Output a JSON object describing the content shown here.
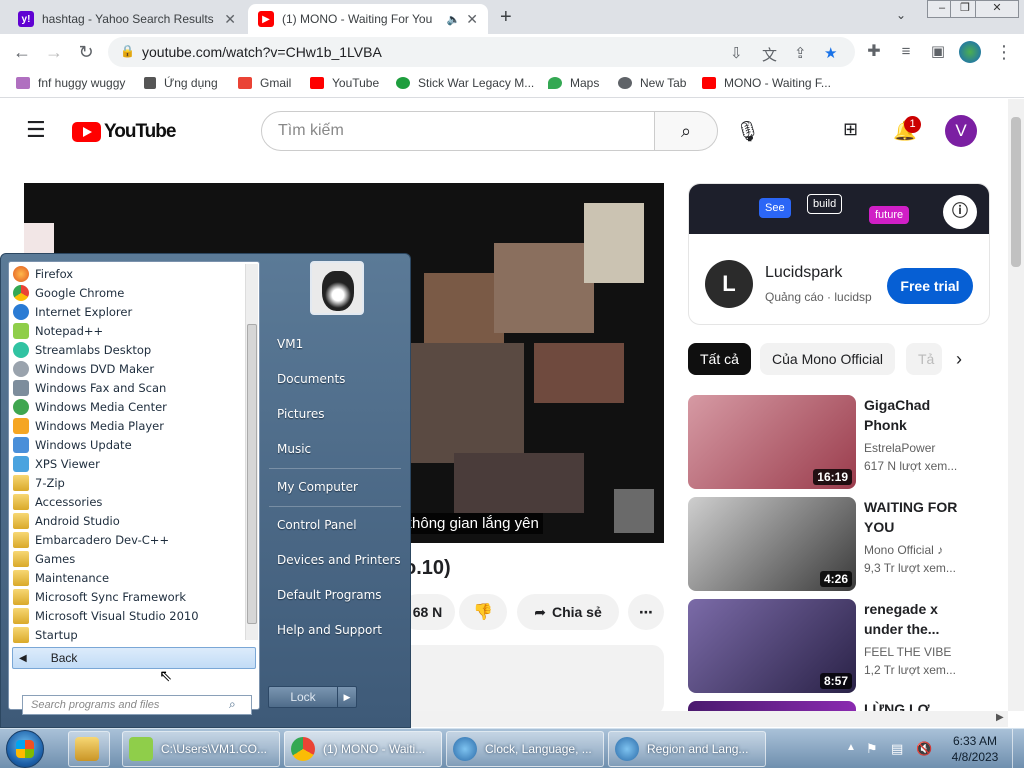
{
  "browser": {
    "tabs": [
      {
        "title": "hashtag - Yahoo Search Results",
        "favicon": "yahoo-icon",
        "color": "#6001d2"
      },
      {
        "title": "(1) MONO - Waiting For You",
        "favicon": "youtube-icon",
        "color": "#ff0000"
      }
    ],
    "new_tab": "+",
    "url": "youtube.com/watch?v=CHw1b_1LVBA",
    "bookmarks": [
      "fnf huggy wuggy",
      "Ứng dụng",
      "Gmail",
      "YouTube",
      "Stick War Legacy M...",
      "Maps",
      "New Tab",
      "MONO - Waiting F..."
    ]
  },
  "youtube": {
    "logo_text": "YouTube",
    "search_placeholder": "Tìm kiếm",
    "notification_count": "1",
    "avatar_letter": "V",
    "caption": "g không gian lắng yên",
    "title_fragment": "o.10)",
    "like_count": "68 N",
    "share_label": "Chia sẻ",
    "ad": {
      "banner_words": [
        "See",
        "build",
        "future"
      ],
      "advertiser": "Lucidspark",
      "label": "Quảng cáo · lucidsp",
      "cta": "Free trial"
    },
    "chips": [
      "Tất cả",
      "Của Mono Official",
      "Tả"
    ],
    "recommendations": [
      {
        "title": "GigaChad Phonk",
        "channel": "EstrelaPower",
        "views": "617 N lượt xem...",
        "duration": "16:19"
      },
      {
        "title": "WAITING FOR YOU",
        "channel": "Mono Official ♪",
        "views": "9,3 Tr lượt xem...",
        "duration": "4:26"
      },
      {
        "title": "renegade x under the...",
        "channel": "FEEL THE VIBE",
        "views": "1,2 Tr lượt xem...",
        "duration": "8:57"
      },
      {
        "title": "LỪNG LƠ",
        "channel": "",
        "views": "",
        "duration": ""
      }
    ]
  },
  "startmenu": {
    "programs": [
      "Firefox",
      "Google Chrome",
      "Internet Explorer",
      "Notepad++",
      "Streamlabs Desktop",
      "Windows DVD Maker",
      "Windows Fax and Scan",
      "Windows Media Center",
      "Windows Media Player",
      "Windows Update",
      "XPS Viewer",
      "7-Zip",
      "Accessories",
      "Android Studio",
      "Embarcadero Dev-C++",
      "Games",
      "Maintenance",
      "Microsoft Sync Framework",
      "Microsoft Visual Studio 2010",
      "Startup"
    ],
    "back_label": "Back",
    "search_placeholder": "Search programs and files",
    "right_links": [
      "VM1",
      "Documents",
      "Pictures",
      "Music",
      "My Computer",
      "Control Panel",
      "Devices and Printers",
      "Default Programs",
      "Help and Support"
    ],
    "lock_label": "Lock"
  },
  "taskbar": {
    "buttons": [
      "C:\\Users\\VM1.CO...",
      "(1) MONO - Waiti...",
      "Clock, Language, ...",
      "Region and Lang..."
    ],
    "time": "6:33 AM",
    "date": "4/8/2023"
  }
}
